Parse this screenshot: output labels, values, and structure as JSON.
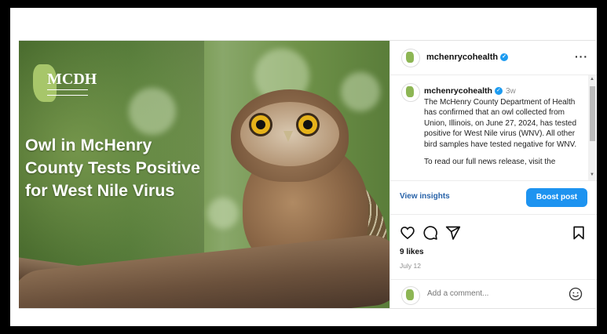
{
  "post": {
    "image": {
      "logo_text": "MCDH",
      "headline": "Owl in McHenry County Tests Positive for West Nile Virus"
    },
    "header": {
      "username": "mchenrycohealth",
      "verified": true,
      "more_icon": "more-horizontal-icon"
    },
    "caption": {
      "username": "mchenrycohealth",
      "time_ago": "3w",
      "paragraph1": "The McHenry County Department of Health has confirmed that an owl collected from Union, Illinois, on June 27, 2024, has tested positive for West Nile virus (WNV). All other bird samples have tested negative for WNV.",
      "paragraph2": "To read our full news release, visit the"
    },
    "insights": {
      "view_insights": "View insights",
      "boost_post": "Boost post"
    },
    "actions": {
      "icons": [
        "heart-icon",
        "comment-icon",
        "share-icon",
        "bookmark-icon"
      ],
      "likes": "9 likes",
      "date": "July 12"
    },
    "comment": {
      "placeholder": "Add a comment...",
      "emoji_icon": "emoji-icon"
    },
    "colors": {
      "accent_blue": "#1d93f0",
      "link_blue": "#2762a8",
      "verified_blue": "#1d9bf0"
    }
  }
}
